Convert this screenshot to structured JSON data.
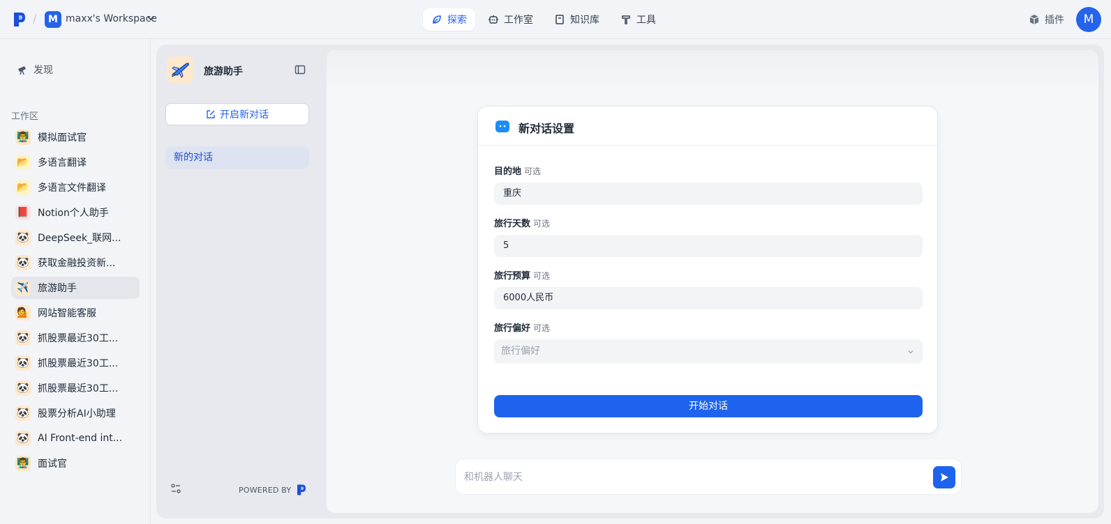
{
  "workspace": {
    "avatar_letter": "M",
    "name": "maxx's Workspace"
  },
  "nav": {
    "explore": "探索",
    "studio": "工作室",
    "knowledge": "知识库",
    "tools": "工具"
  },
  "header": {
    "plugins": "插件",
    "user_initial": "M"
  },
  "sidebar": {
    "discover": "发现",
    "section_label": "工作区",
    "items": [
      {
        "label": "模拟面试官",
        "icon": "interviewer-icon",
        "emoji": "👨‍🏫",
        "bg": "#fde7c3"
      },
      {
        "label": "多语言翻译",
        "icon": "folder-icon",
        "emoji": "📂",
        "bg": "#fff3c8"
      },
      {
        "label": "多语言文件翻译",
        "icon": "folder-icon",
        "emoji": "📂",
        "bg": "#fff3c8"
      },
      {
        "label": "Notion个人助手",
        "icon": "notebook-icon",
        "emoji": "📕",
        "bg": "#fde2e2"
      },
      {
        "label": "DeepSeek_联网...",
        "icon": "robot-icon",
        "emoji": "🐼",
        "bg": "#ffe8cc"
      },
      {
        "label": "获取金融投资新...",
        "icon": "robot-icon",
        "emoji": "🐼",
        "bg": "#ffe8cc"
      },
      {
        "label": "旅游助手",
        "icon": "airplane-icon",
        "emoji": "✈️",
        "bg": "#ffe8cc"
      },
      {
        "label": "网站智能客服",
        "icon": "support-agent-icon",
        "emoji": "💁",
        "bg": "#ffe8cc"
      },
      {
        "label": "抓股票最近30工...",
        "icon": "robot-icon",
        "emoji": "🐼",
        "bg": "#ffe8cc"
      },
      {
        "label": "抓股票最近30工...",
        "icon": "robot-icon",
        "emoji": "🐼",
        "bg": "#ffe8cc"
      },
      {
        "label": "抓股票最近30工...",
        "icon": "robot-icon",
        "emoji": "🐼",
        "bg": "#ffe8cc"
      },
      {
        "label": "股票分析AI小助理",
        "icon": "robot-icon",
        "emoji": "🐼",
        "bg": "#ffe8cc"
      },
      {
        "label": "AI Front-end int...",
        "icon": "robot-icon",
        "emoji": "🐼",
        "bg": "#ffe8cc"
      },
      {
        "label": "面试官",
        "icon": "interviewer-icon",
        "emoji": "👨‍🏫",
        "bg": "#fde7c3"
      }
    ],
    "active_index": 6
  },
  "conversation_panel": {
    "bot_name": "旅游助手",
    "new_chat": "开启新对话",
    "conversations": [
      "新的对话"
    ],
    "powered_by": "POWERED BY"
  },
  "form": {
    "title": "新对话设置",
    "optional_tag": "可选",
    "fields": [
      {
        "label": "目的地",
        "value": "重庆"
      },
      {
        "label": "旅行天数",
        "value": "5"
      },
      {
        "label": "旅行预算",
        "value": "6000人民币"
      },
      {
        "label": "旅行偏好",
        "placeholder": "旅行偏好"
      }
    ],
    "submit": "开始对话"
  },
  "chat": {
    "placeholder": "和机器人聊天"
  },
  "colors": {
    "accent": "#1d63ed",
    "brand": "#2563eb"
  }
}
